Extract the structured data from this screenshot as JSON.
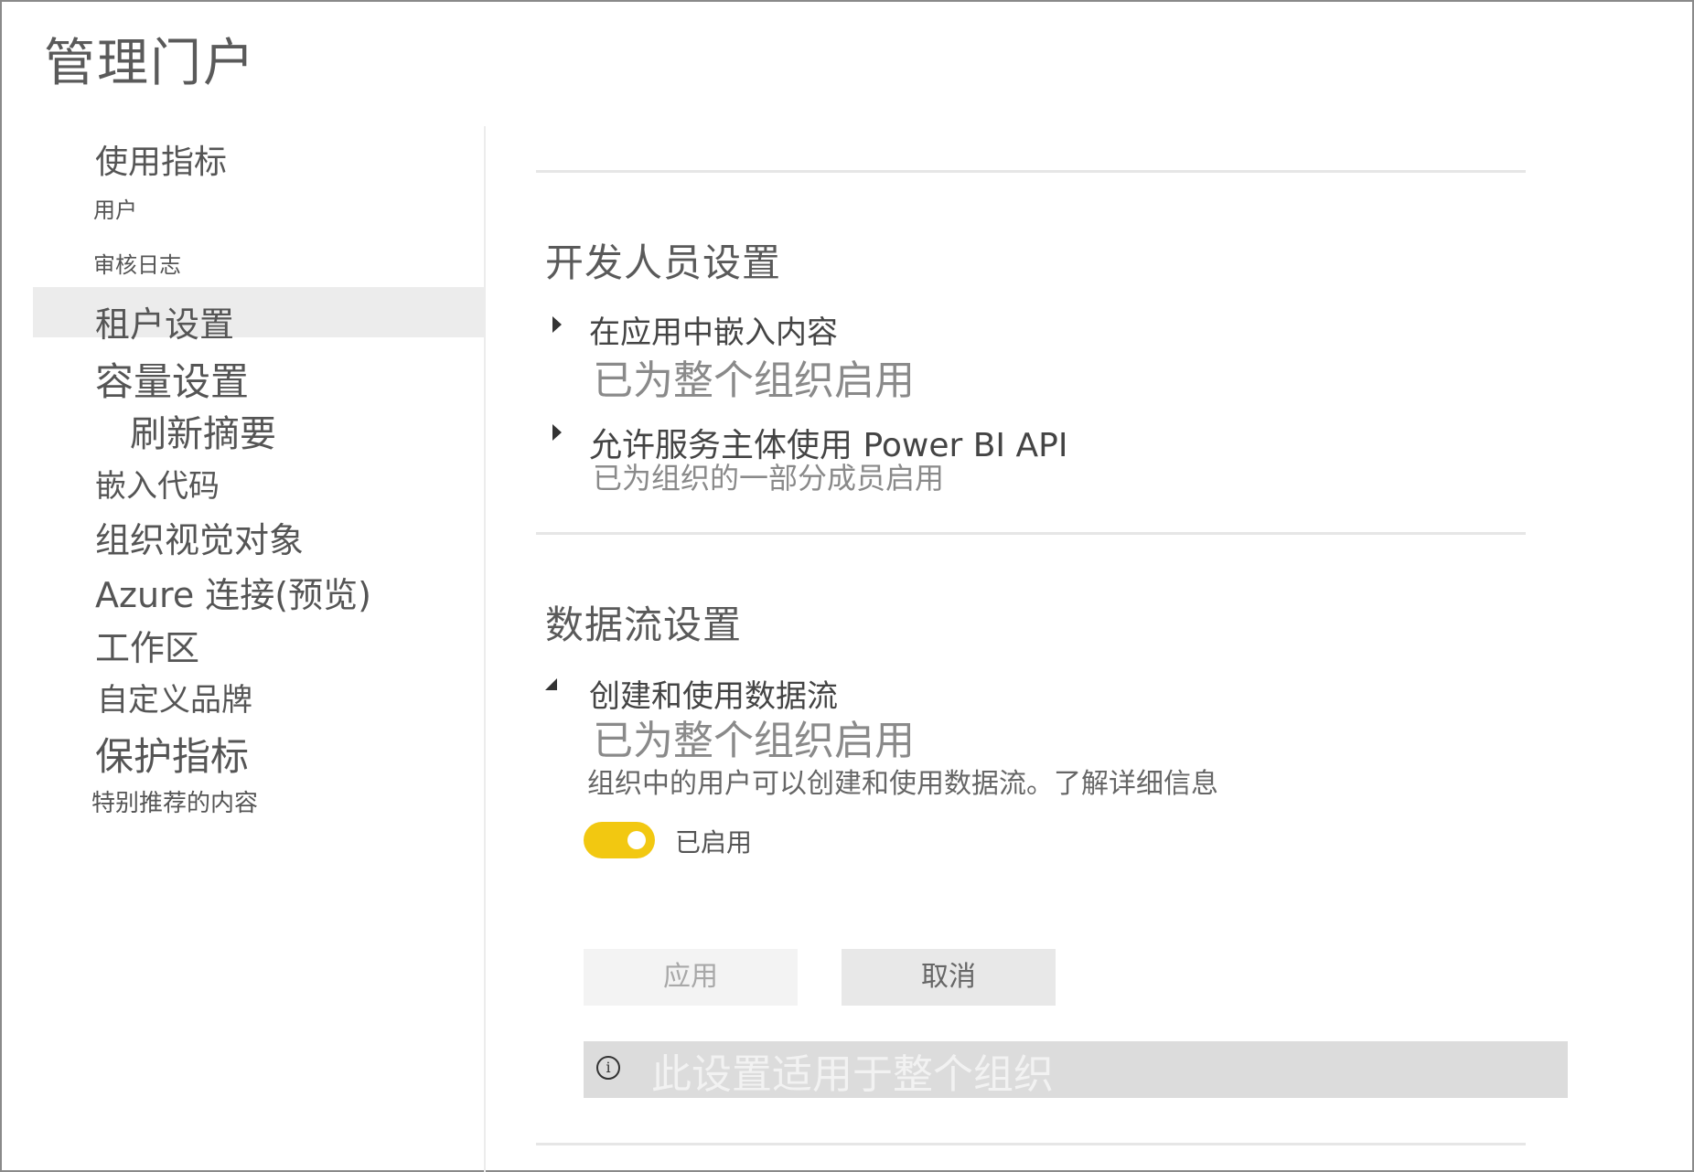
{
  "page_title": "管理门户",
  "sidebar": {
    "items": [
      {
        "label": "使用指标"
      },
      {
        "label": "用户"
      },
      {
        "label": "审核日志"
      },
      {
        "label": "租户设置",
        "active": true
      },
      {
        "label": "容量设置"
      },
      {
        "label": "刷新摘要"
      },
      {
        "label": "嵌入代码"
      },
      {
        "label": "组织视觉对象"
      },
      {
        "label": "Azure 连接(预览)"
      },
      {
        "label": "工作区"
      },
      {
        "label": "自定义品牌"
      },
      {
        "label": "保护指标"
      },
      {
        "label": "特别推荐的内容"
      }
    ]
  },
  "main": {
    "sections": [
      {
        "title": "开发人员设置",
        "settings": [
          {
            "title": "在应用中嵌入内容",
            "status": "已为整个组织启用",
            "expanded": false
          },
          {
            "title": "允许服务主体使用 Power BI API",
            "status": "已为组织的一部分成员启用",
            "expanded": false
          }
        ]
      },
      {
        "title": "数据流设置",
        "settings": [
          {
            "title": "创建和使用数据流",
            "status": "已为整个组织启用",
            "expanded": true,
            "description": "组织中的用户可以创建和使用数据流。",
            "learn_more": "了解详细信息",
            "toggle": {
              "state": "on",
              "label": "已启用",
              "color": "#f2c811"
            },
            "apply_label": "应用",
            "cancel_label": "取消",
            "info_icon": "info-circle-icon",
            "info_text": "此设置适用于整个组织"
          }
        ]
      }
    ]
  }
}
